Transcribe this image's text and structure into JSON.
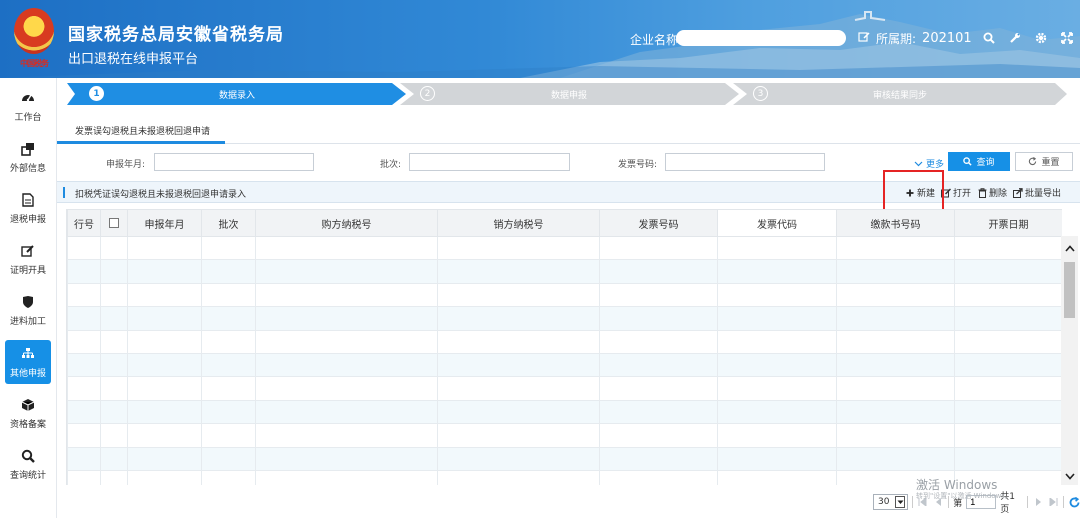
{
  "header": {
    "title": "国家税务总局安徽省税务局",
    "subtitle": "出口退税在线申报平台",
    "logo_text": "中国税务",
    "company_label": "企业名称",
    "period_label": "所属期:",
    "period_value": "202101"
  },
  "sidebar": {
    "items": [
      {
        "label": "工作台",
        "icon": "dashboard-icon"
      },
      {
        "label": "外部信息",
        "icon": "external-link-icon"
      },
      {
        "label": "退税申报",
        "icon": "document-icon"
      },
      {
        "label": "证明开具",
        "icon": "edit-icon"
      },
      {
        "label": "进料加工",
        "icon": "shield-icon"
      },
      {
        "label": "其他申报",
        "icon": "sitemap-icon",
        "active": true
      },
      {
        "label": "资格备案",
        "icon": "cube-icon"
      },
      {
        "label": "查询统计",
        "icon": "search-icon"
      }
    ]
  },
  "steps": [
    {
      "num": "1",
      "label": "数据录入",
      "active": true
    },
    {
      "num": "2",
      "label": "数据申报",
      "active": false
    },
    {
      "num": "3",
      "label": "审核结果同步",
      "active": false
    }
  ],
  "tab": {
    "label": "发票误勾退税且未报退税回退申请"
  },
  "filters": {
    "period_label": "申报年月:",
    "batch_label": "批次:",
    "invoice_label": "发票号码:",
    "more_label": "更多",
    "query_label": "查询",
    "reset_label": "重置"
  },
  "section": {
    "title": "扣税凭证误勾退税且未报退税回退申请录入",
    "new_label": "新建",
    "open_label": "打开",
    "delete_label": "删除",
    "export_label": "批量导出"
  },
  "table": {
    "columns": [
      "行号",
      "",
      "申报年月",
      "批次",
      "购方纳税号",
      "销方纳税号",
      "发票号码",
      "发票代码",
      "缴款书号码",
      "开票日期"
    ],
    "row_count": 11
  },
  "pager": {
    "page_size": "30",
    "page_prefix": "第",
    "page_value": "1",
    "total_label": "共1页"
  },
  "watermark": {
    "line1": "激活 Windows",
    "line2": "转到\"设置\"以激活 Windows。"
  }
}
